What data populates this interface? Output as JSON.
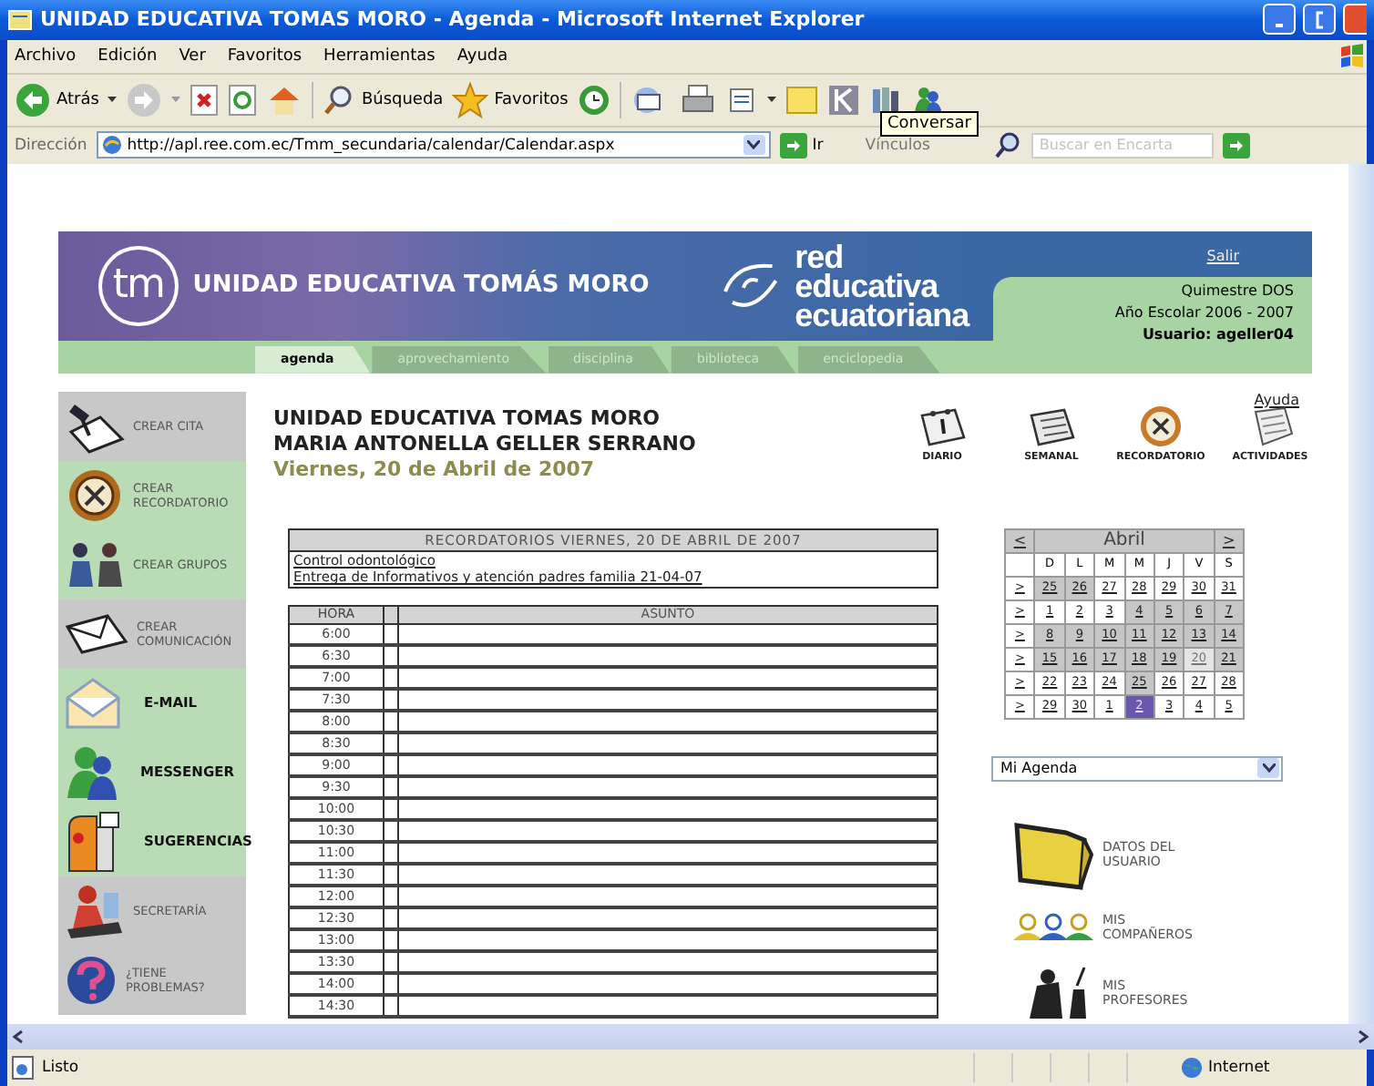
{
  "window": {
    "title": "UNIDAD EDUCATIVA TOMAS MORO - Agenda - Microsoft Internet Explorer"
  },
  "menu": [
    "Archivo",
    "Edición",
    "Ver",
    "Favoritos",
    "Herramientas",
    "Ayuda"
  ],
  "toolbar": {
    "back": "Atrás",
    "search": "Búsqueda",
    "favorites": "Favoritos",
    "tooltip": "Conversar"
  },
  "address": {
    "label": "Dirección",
    "url": "http://apl.ree.com.ec/Tmm_secundaria/calendar/Calendar.aspx",
    "go": "Ir",
    "links": "Vínculos",
    "encarta_placeholder": "Buscar en Encarta"
  },
  "banner": {
    "logo": "tm",
    "school": "UNIDAD EDUCATIVA TOMÁS MORO",
    "network": [
      "red educativa",
      "ecuatoriana"
    ],
    "logout": "Salir",
    "term": "Quimestre DOS",
    "year": "Año Escolar 2006 - 2007",
    "user": "Usuario: ageller04"
  },
  "tabs": [
    {
      "label": "agenda",
      "selected": true
    },
    {
      "label": "aprovechamiento",
      "selected": false
    },
    {
      "label": "disciplina",
      "selected": false
    },
    {
      "label": "biblioteca",
      "selected": false
    },
    {
      "label": "enciclopedia",
      "selected": false
    }
  ],
  "sidebar": {
    "items": [
      {
        "label": "CREAR CITA",
        "kind": "appointment",
        "color": "#c8c8c8",
        "emphasis": false
      },
      {
        "label": "CREAR RECORDATORIO",
        "kind": "reminder",
        "color": "#b9dbb5",
        "emphasis": false
      },
      {
        "label": "CREAR GRUPOS",
        "kind": "groups",
        "color": "#b9dbb5",
        "emphasis": false
      },
      {
        "label": "CREAR COMUNICACIÓN",
        "kind": "message",
        "color": "#c8c8c8",
        "emphasis": false
      },
      {
        "label": "E-MAIL",
        "kind": "email",
        "color": "#b9dbb5",
        "emphasis": true
      },
      {
        "label": "MESSENGER",
        "kind": "messenger",
        "color": "#b9dbb5",
        "emphasis": true
      },
      {
        "label": "SUGERENCIAS",
        "kind": "suggestions",
        "color": "#b9dbb5",
        "emphasis": true
      },
      {
        "label": "SECRETARÍA",
        "kind": "secretary",
        "color": "#c8c8c8",
        "emphasis": false
      },
      {
        "label": "¿TIENE PROBLEMAS?",
        "kind": "help",
        "color": "#c8c8c8",
        "emphasis": false
      }
    ]
  },
  "heading": {
    "school": "UNIDAD EDUCATIVA TOMAS MORO",
    "student": "MARIA ANTONELLA GELLER SERRANO",
    "date": "Viernes, 20 de Abril de 2007"
  },
  "views": {
    "help": "Ayuda",
    "items": [
      {
        "label": "DIARIO",
        "kind": "daily"
      },
      {
        "label": "SEMANAL",
        "kind": "weekly"
      },
      {
        "label": "RECORDATORIO",
        "kind": "reminder"
      },
      {
        "label": "ACTIVIDADES",
        "kind": "activities"
      }
    ]
  },
  "reminders": {
    "title": "RECORDATORIOS VIERNES, 20 DE ABRIL DE 2007",
    "items": [
      "Control odontológico",
      "Entrega de Informativos y atención padres familia 21-04-07"
    ]
  },
  "schedule": {
    "columns": [
      "HORA",
      "ASUNTO"
    ],
    "rows": [
      "6:00",
      "6:30",
      "7:00",
      "7:30",
      "8:00",
      "8:30",
      "9:00",
      "9:30",
      "10:00",
      "10:30",
      "11:00",
      "11:30",
      "12:00",
      "12:30",
      "13:00",
      "13:30",
      "14:00",
      "14:30"
    ]
  },
  "calendar": {
    "prev": "<",
    "month": "Abril",
    "next": ">",
    "weekdays": [
      "D",
      "L",
      "M",
      "M",
      "J",
      "V",
      "S"
    ],
    "weeks": [
      {
        "select": ">",
        "days": [
          {
            "day": "25",
            "kind": "shaded"
          },
          {
            "day": "26",
            "kind": "shaded"
          },
          {
            "day": "27",
            "kind": "plain"
          },
          {
            "day": "28",
            "kind": "plain"
          },
          {
            "day": "29",
            "kind": "plain"
          },
          {
            "day": "30",
            "kind": "plain"
          },
          {
            "day": "31",
            "kind": "plain"
          }
        ]
      },
      {
        "select": ">",
        "days": [
          {
            "day": "1",
            "kind": "plain"
          },
          {
            "day": "2",
            "kind": "plain"
          },
          {
            "day": "3",
            "kind": "plain"
          },
          {
            "day": "4",
            "kind": "shaded"
          },
          {
            "day": "5",
            "kind": "shaded"
          },
          {
            "day": "6",
            "kind": "shaded"
          },
          {
            "day": "7",
            "kind": "shaded"
          }
        ]
      },
      {
        "select": ">",
        "days": [
          {
            "day": "8",
            "kind": "shaded"
          },
          {
            "day": "9",
            "kind": "shaded"
          },
          {
            "day": "10",
            "kind": "shaded"
          },
          {
            "day": "11",
            "kind": "shaded"
          },
          {
            "day": "12",
            "kind": "shaded"
          },
          {
            "day": "13",
            "kind": "shaded"
          },
          {
            "day": "14",
            "kind": "shaded"
          }
        ]
      },
      {
        "select": ">",
        "days": [
          {
            "day": "15",
            "kind": "shaded"
          },
          {
            "day": "16",
            "kind": "shaded"
          },
          {
            "day": "17",
            "kind": "shaded"
          },
          {
            "day": "18",
            "kind": "shaded"
          },
          {
            "day": "19",
            "kind": "shaded"
          },
          {
            "day": "20",
            "kind": "selected"
          },
          {
            "day": "21",
            "kind": "shaded"
          }
        ]
      },
      {
        "select": ">",
        "days": [
          {
            "day": "22",
            "kind": "plain"
          },
          {
            "day": "23",
            "kind": "plain"
          },
          {
            "day": "24",
            "kind": "plain"
          },
          {
            "day": "25",
            "kind": "shaded"
          },
          {
            "day": "26",
            "kind": "plain"
          },
          {
            "day": "27",
            "kind": "plain"
          },
          {
            "day": "28",
            "kind": "plain"
          }
        ]
      },
      {
        "select": ">",
        "days": [
          {
            "day": "29",
            "kind": "plain"
          },
          {
            "day": "30",
            "kind": "plain"
          },
          {
            "day": "1",
            "kind": "plain"
          },
          {
            "day": "2",
            "kind": "today"
          },
          {
            "day": "3",
            "kind": "plain"
          },
          {
            "day": "4",
            "kind": "plain"
          },
          {
            "day": "5",
            "kind": "plain"
          }
        ]
      }
    ]
  },
  "agenda_select": {
    "value": "Mi Agenda"
  },
  "shortcuts": [
    {
      "label": "DATOS DEL USUARIO",
      "kind": "folder"
    },
    {
      "label": "MIS COMPAÑEROS",
      "kind": "people"
    },
    {
      "label": "MIS PROFESORES",
      "kind": "teacher"
    }
  ],
  "status": {
    "text": "Listo",
    "zone": "Internet"
  }
}
